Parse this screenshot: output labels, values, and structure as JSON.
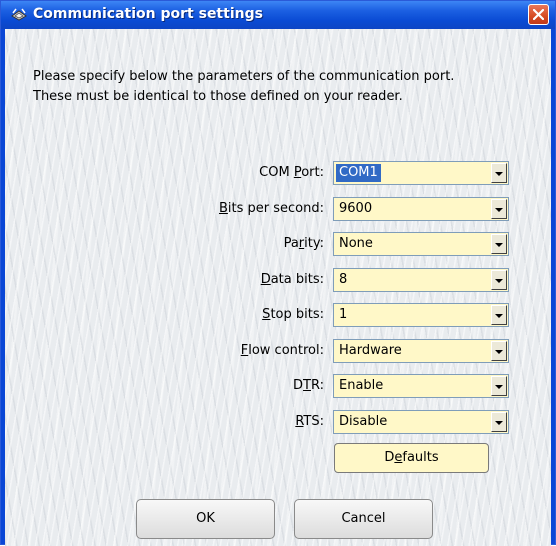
{
  "window": {
    "title": "Communication port settings"
  },
  "intro": {
    "line1": "Please specify below the parameters of the communication port.",
    "line2": "These must be identical to those defined on your reader."
  },
  "fields": [
    {
      "label_pre": "COM ",
      "label_key": "P",
      "label_post": "ort:",
      "value": "COM1"
    },
    {
      "label_pre": "",
      "label_key": "B",
      "label_post": "its per second:",
      "value": "9600"
    },
    {
      "label_pre": "Pa",
      "label_key": "r",
      "label_post": "ity:",
      "value": "None"
    },
    {
      "label_pre": "",
      "label_key": "D",
      "label_post": "ata bits:",
      "value": "8"
    },
    {
      "label_pre": "",
      "label_key": "S",
      "label_post": "top bits:",
      "value": "1"
    },
    {
      "label_pre": "",
      "label_key": "F",
      "label_post": "low control:",
      "value": "Hardware"
    },
    {
      "label_pre": "D",
      "label_key": "T",
      "label_post": "R:",
      "value": "Enable"
    },
    {
      "label_pre": "",
      "label_key": "R",
      "label_post": "TS:",
      "value": "Disable"
    }
  ],
  "buttons": {
    "defaults_pre": "D",
    "defaults_key": "e",
    "defaults_post": "faults",
    "ok": "OK",
    "cancel": "Cancel"
  },
  "icons": {
    "title": "serial-port-icon",
    "close": "close-icon"
  },
  "colors": {
    "title_bar": "#0a4bd4",
    "close_button": "#d64a22",
    "field_background": "#fff8c8",
    "selection": "#316ac5"
  }
}
